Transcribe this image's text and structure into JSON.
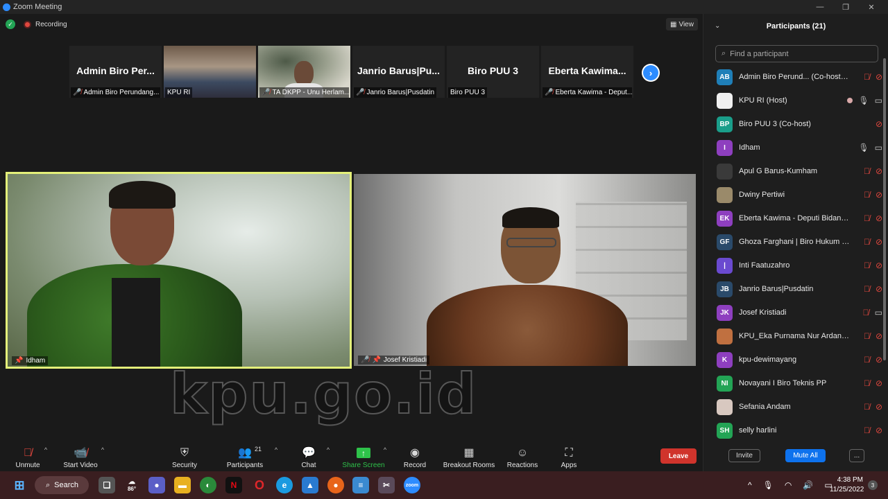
{
  "window": {
    "title": "Zoom Meeting",
    "minimize": "—",
    "restore": "❐",
    "close": "✕"
  },
  "meeting": {
    "recording_label": "Recording",
    "view_label": "View",
    "thumbnails": [
      {
        "big": "Admin Biro Per...",
        "caption": "Admin Biro Perundang...",
        "muted": true
      },
      {
        "big": "",
        "caption": "KPU RI",
        "muted": false
      },
      {
        "big": "",
        "caption": "TA DKPP - Unu Herlam...",
        "muted": true
      },
      {
        "big": "Janrio Barus|Pu...",
        "caption": "Janrio Barus|Pusdatin",
        "muted": true
      },
      {
        "big": "Biro PUU 3",
        "caption": "Biro PUU 3",
        "muted": false
      },
      {
        "big": "Eberta Kawima...",
        "caption": "Eberta Kawima - Deput...",
        "muted": true
      }
    ],
    "main_left_name": "Idham",
    "main_right_name": "Josef Kristiadi",
    "watermark": "kpu.go.id"
  },
  "toolbar": {
    "unmute": "Unmute",
    "start_video": "Start Video",
    "security": "Security",
    "participants": "Participants",
    "participants_count": "21",
    "chat": "Chat",
    "share_screen": "Share Screen",
    "record": "Record",
    "breakout_rooms": "Breakout Rooms",
    "reactions": "Reactions",
    "apps": "Apps",
    "leave": "Leave"
  },
  "panel": {
    "title": "Participants (21)",
    "search_placeholder": "Find a participant",
    "invite": "Invite",
    "mute_all": "Mute All",
    "more": "...",
    "participants": [
      {
        "initials": "AB",
        "color": "#1f7fb8",
        "name": "Admin Biro Perund... (Co-host, me)",
        "mic": "off",
        "cam": "off"
      },
      {
        "initials": "",
        "color": "#f0f0f0",
        "name": "KPU RI (Host)",
        "mic": "on",
        "cam": "on",
        "rec": true
      },
      {
        "initials": "BP",
        "color": "#1a9e8a",
        "name": "Biro PUU 3 (Co-host)",
        "mic": "none",
        "cam": "off"
      },
      {
        "initials": "I",
        "color": "#8e3fbf",
        "name": "Idham",
        "mic": "on",
        "cam": "on"
      },
      {
        "initials": "",
        "color": "#3a3a3a",
        "name": "Apul G Barus-Kumham",
        "mic": "off",
        "cam": "off"
      },
      {
        "initials": "",
        "color": "#9a8a6a",
        "name": "Dwiny Pertiwi",
        "mic": "off",
        "cam": "off"
      },
      {
        "initials": "EK",
        "color": "#8e3fbf",
        "name": "Eberta Kawima - Deputi Bidang T...",
        "mic": "off",
        "cam": "off"
      },
      {
        "initials": "GF",
        "color": "#2a4a6a",
        "name": "Ghoza Farghani | Biro Hukum da...",
        "mic": "off",
        "cam": "off"
      },
      {
        "initials": "|",
        "color": "#6a4ad0",
        "name": "Inti Faatuzahro",
        "mic": "off",
        "cam": "off"
      },
      {
        "initials": "JB",
        "color": "#2a4a6a",
        "name": "Janrio Barus|Pusdatin",
        "mic": "off",
        "cam": "off"
      },
      {
        "initials": "JK",
        "color": "#8e3fbf",
        "name": "Josef Kristiadi",
        "mic": "off",
        "cam": "on"
      },
      {
        "initials": "",
        "color": "#c07040",
        "name": "KPU_Eka Purnama Nur Ardani A...",
        "mic": "off",
        "cam": "off"
      },
      {
        "initials": "K",
        "color": "#8e3fbf",
        "name": "kpu-dewimayang",
        "mic": "off",
        "cam": "off"
      },
      {
        "initials": "NI",
        "color": "#23a455",
        "name": "Novayani I Biro Teknis PP",
        "mic": "off",
        "cam": "off"
      },
      {
        "initials": "",
        "color": "#d8c8c0",
        "name": "Sefania Andam",
        "mic": "off",
        "cam": "off"
      },
      {
        "initials": "SH",
        "color": "#23a455",
        "name": "selly harlini",
        "mic": "off",
        "cam": "off"
      }
    ]
  },
  "taskbar": {
    "search_label": "Search",
    "weather": "86°",
    "time": "4:38 PM",
    "date": "11/25/2022",
    "notifications": "3"
  }
}
